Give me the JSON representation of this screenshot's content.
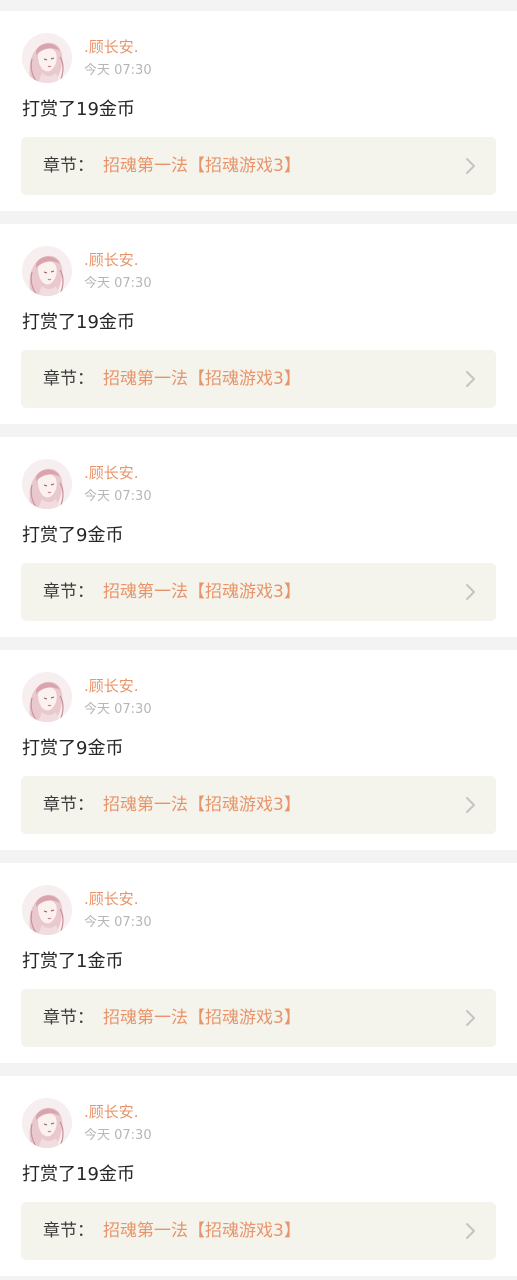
{
  "posts": [
    {
      "username": ".顾长安.",
      "time": "今天 07:30",
      "reward": "打赏了19金币",
      "chapter_label": "章节：",
      "chapter_title": "招魂第一法【招魂游戏3】"
    },
    {
      "username": ".顾长安.",
      "time": "今天 07:30",
      "reward": "打赏了19金币",
      "chapter_label": "章节：",
      "chapter_title": "招魂第一法【招魂游戏3】"
    },
    {
      "username": ".顾长安.",
      "time": "今天 07:30",
      "reward": "打赏了9金币",
      "chapter_label": "章节：",
      "chapter_title": "招魂第一法【招魂游戏3】"
    },
    {
      "username": ".顾长安.",
      "time": "今天 07:30",
      "reward": "打赏了9金币",
      "chapter_label": "章节：",
      "chapter_title": "招魂第一法【招魂游戏3】"
    },
    {
      "username": ".顾长安.",
      "time": "今天 07:30",
      "reward": "打赏了1金币",
      "chapter_label": "章节：",
      "chapter_title": "招魂第一法【招魂游戏3】"
    },
    {
      "username": ".顾长安.",
      "time": "今天 07:30",
      "reward": "打赏了19金币",
      "chapter_label": "章节：",
      "chapter_title": "招魂第一法【招魂游戏3】"
    }
  ],
  "icons": {
    "avatar": "avatar-anime-girl-icon",
    "chevron": "chevron-right-icon"
  },
  "colors": {
    "accent": "#e8946a",
    "chapter_bg": "#f4f4ec",
    "page_bg": "#f4f3f3",
    "card_bg": "#ffffff",
    "timestamp": "#b6b6b6"
  }
}
